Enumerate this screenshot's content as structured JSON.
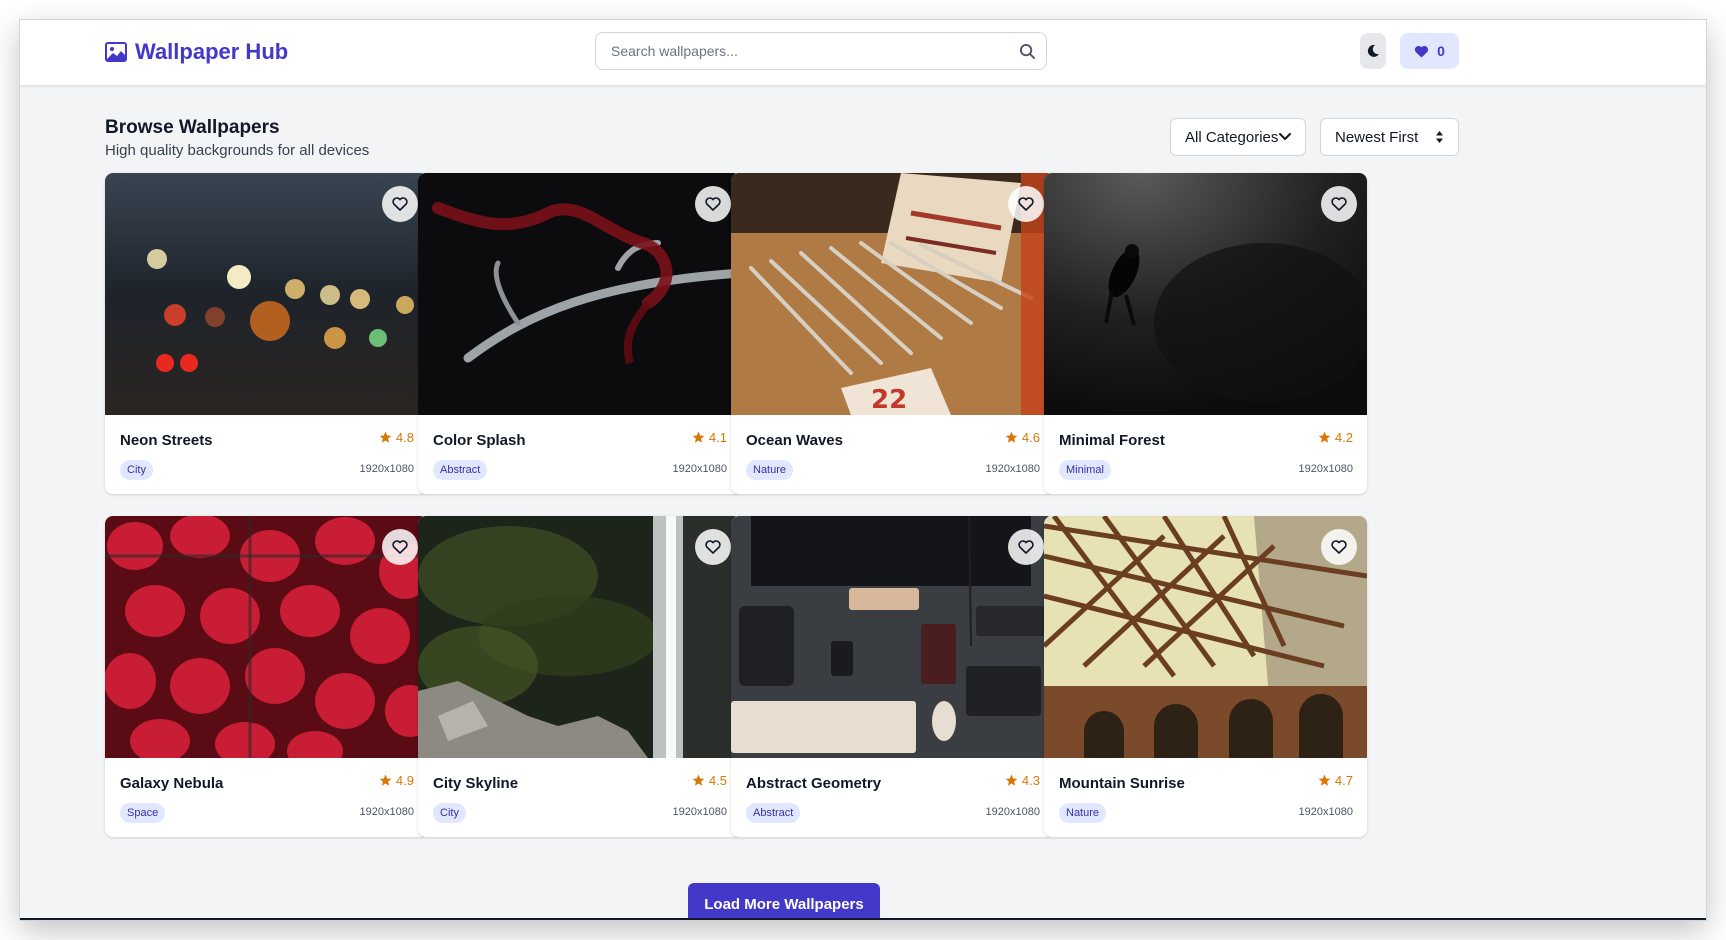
{
  "header": {
    "brand": "Wallpaper Hub",
    "search_placeholder": "Search wallpapers...",
    "favorites_count": "0"
  },
  "page": {
    "title": "Browse Wallpapers",
    "subtitle": "High quality backgrounds for all devices"
  },
  "filters": {
    "category": "All Categories",
    "sort": "Newest First"
  },
  "cards": [
    {
      "title": "Neon Streets",
      "rating": "4.8",
      "tag": "City",
      "resolution": "1920x1080"
    },
    {
      "title": "Color Splash",
      "rating": "4.1",
      "tag": "Abstract",
      "resolution": "1920x1080"
    },
    {
      "title": "Ocean Waves",
      "rating": "4.6",
      "tag": "Nature",
      "resolution": "1920x1080"
    },
    {
      "title": "Minimal Forest",
      "rating": "4.2",
      "tag": "Minimal",
      "resolution": "1920x1080"
    },
    {
      "title": "Galaxy Nebula",
      "rating": "4.9",
      "tag": "Space",
      "resolution": "1920x1080"
    },
    {
      "title": "City Skyline",
      "rating": "4.5",
      "tag": "City",
      "resolution": "1920x1080"
    },
    {
      "title": "Abstract Geometry",
      "rating": "4.3",
      "tag": "Abstract",
      "resolution": "1920x1080"
    },
    {
      "title": "Mountain Sunrise",
      "rating": "4.7",
      "tag": "Nature",
      "resolution": "1920x1080"
    }
  ],
  "load_more_label": "Load More Wallpapers",
  "icons": {
    "brand": "image-icon",
    "search": "search-icon",
    "theme": "moon-icon",
    "favorites": "heart-filled-icon",
    "card_favorite": "heart-outline-icon",
    "rating": "star-icon",
    "category_dropdown": "chevron-down-icon",
    "sort_dropdown": "sort-arrows-icon"
  },
  "colors": {
    "accent": "#4338ca",
    "accent_soft": "#e0e7ff",
    "rating": "#d97706",
    "background": "#f3f4f6"
  }
}
